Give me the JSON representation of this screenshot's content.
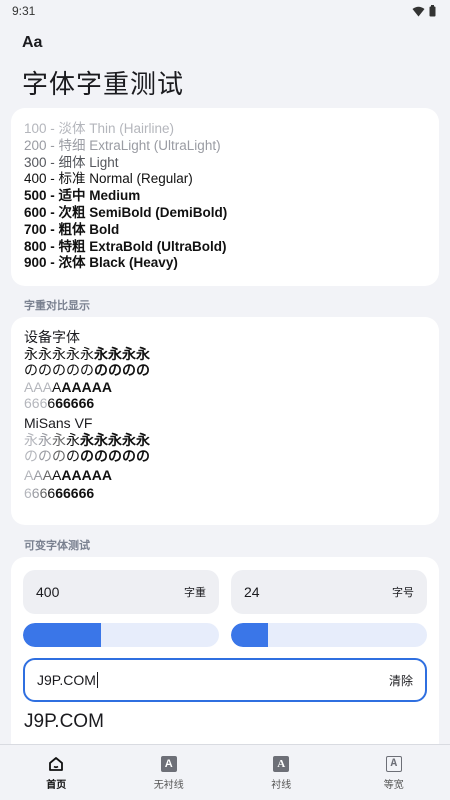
{
  "status": {
    "time": "9:31"
  },
  "app": {
    "logo": "Aa",
    "title": "字体字重测试"
  },
  "weights": [
    {
      "text": "100 - 淡体 Thin (Hairline)",
      "weight": 100
    },
    {
      "text": "200 - 特细 ExtraLight (UltraLight)",
      "weight": 200
    },
    {
      "text": "300 - 细体 Light",
      "weight": 300
    },
    {
      "text": "400 - 标准 Normal (Regular)",
      "weight": 400
    },
    {
      "text": "500 - 适中 Medium",
      "weight": 500
    },
    {
      "text": "600 - 次粗 SemiBold (DemiBold)",
      "weight": 600
    },
    {
      "text": "700 - 粗体 Bold",
      "weight": 700
    },
    {
      "text": "800 - 特粗 ExtraBold (UltraBold)",
      "weight": 800
    },
    {
      "text": "900 - 浓体 Black (Heavy)",
      "weight": 900
    }
  ],
  "compare": {
    "section_label": "字重对比显示",
    "groups": [
      {
        "name": "设备字体",
        "rows": [
          {
            "glyph": "永",
            "weights": [
              400,
              400,
              400,
              400,
              400,
              700,
              700,
              700,
              700
            ]
          },
          {
            "glyph": "の",
            "weights": [
              400,
              400,
              400,
              400,
              400,
              700,
              700,
              700,
              700
            ]
          },
          {
            "glyph": "A",
            "weights": [
              100,
              100,
              100,
              400,
              700,
              700,
              700,
              700,
              700
            ]
          },
          {
            "glyph": "6",
            "weights": [
              100,
              100,
              100,
              400,
              700,
              700,
              700,
              700,
              700
            ]
          }
        ]
      },
      {
        "name": "MiSans VF",
        "rows": [
          {
            "glyph": "永",
            "weights": [
              100,
              200,
              300,
              400,
              500,
              600,
              700,
              800,
              900
            ]
          },
          {
            "glyph": "の",
            "weights": [
              100,
              200,
              300,
              400,
              500,
              600,
              700,
              800,
              900
            ]
          },
          {
            "glyph": "A",
            "weights": [
              100,
              200,
              300,
              400,
              500,
              600,
              700,
              800,
              900
            ]
          },
          {
            "glyph": "6",
            "weights": [
              100,
              200,
              300,
              400,
              500,
              600,
              700,
              800,
              900
            ]
          }
        ]
      }
    ]
  },
  "variable": {
    "section_label": "可变字体测试",
    "weight_value": "400",
    "weight_unit": "字重",
    "size_value": "24",
    "size_unit": "字号",
    "weight_slider_fraction": 0.4,
    "size_slider_fraction": 0.19,
    "input_text": "J9P.COM",
    "clear_label": "清除",
    "preview_text": "J9P.COM"
  },
  "nav": {
    "items": [
      {
        "label": "首页",
        "icon": "home-icon",
        "active": true
      },
      {
        "label": "无衬线",
        "icon": "sans-serif-icon",
        "active": false
      },
      {
        "label": "衬线",
        "icon": "serif-icon",
        "active": false
      },
      {
        "label": "等宽",
        "icon": "monospace-icon",
        "active": false
      }
    ]
  },
  "colors": {
    "accent": "#3a76e8",
    "slider_track": "#e7edfb",
    "background": "#f2f3f7"
  }
}
